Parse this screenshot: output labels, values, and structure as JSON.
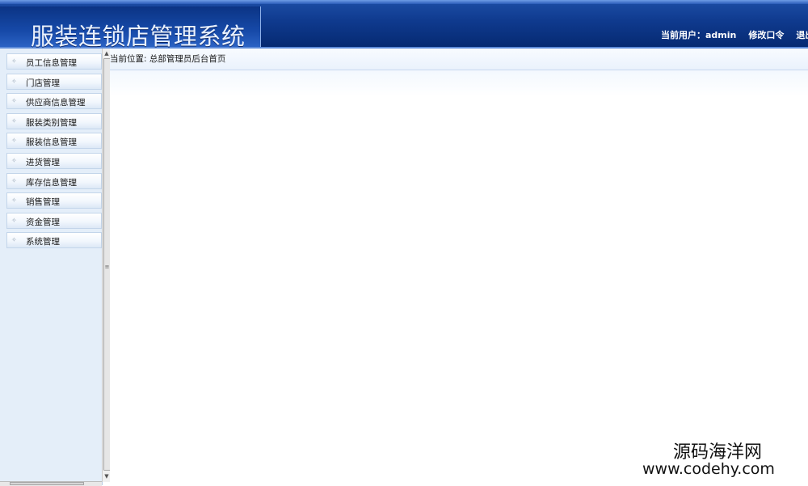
{
  "header": {
    "app_title": "服装连锁店管理系统",
    "current_user_label": "当前用户：admin",
    "change_password_label": "修改口令",
    "logout_label": "退出系统"
  },
  "sidebar": {
    "items": [
      {
        "label": "员工信息管理"
      },
      {
        "label": "门店管理"
      },
      {
        "label": "供应商信息管理"
      },
      {
        "label": "服装类别管理"
      },
      {
        "label": "服装信息管理"
      },
      {
        "label": "进货管理"
      },
      {
        "label": "库存信息管理"
      },
      {
        "label": "销售管理"
      },
      {
        "label": "资金管理"
      },
      {
        "label": "系统管理"
      }
    ]
  },
  "main": {
    "breadcrumb": "当前位置: 总部管理员后台首页"
  },
  "watermark": {
    "cn": "源码海洋网",
    "url": "www.codehy.com"
  },
  "colors": {
    "header_blue": "#0f3a8e",
    "sidebar_bg": "#e4eef9"
  }
}
